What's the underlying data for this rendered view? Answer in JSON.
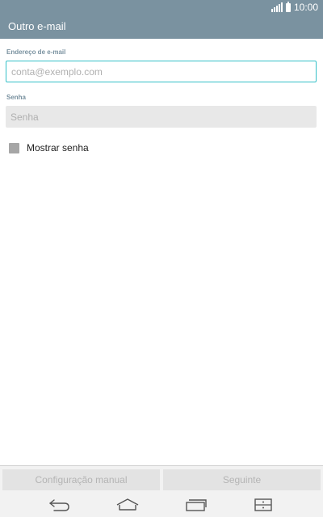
{
  "status_bar": {
    "time": "10:00",
    "icons": [
      "signal-icon",
      "battery-icon"
    ]
  },
  "action_bar": {
    "title": "Outro e-mail"
  },
  "form": {
    "email": {
      "label": "Endereço de e-mail",
      "placeholder": "conta@exemplo.com",
      "value": ""
    },
    "password": {
      "label": "Senha",
      "placeholder": "Senha",
      "value": ""
    },
    "show_password": {
      "label": "Mostrar senha",
      "checked": false
    }
  },
  "buttons": {
    "manual_setup": "Configuração manual",
    "next": "Seguinte"
  },
  "nav_bar": {
    "icons": [
      "back-icon",
      "home-icon",
      "recent-apps-icon",
      "menu-icon"
    ]
  },
  "colors": {
    "header": "#7a92a0",
    "focus_border": "#34c0c8",
    "disabled_text": "#b4b4b4"
  }
}
